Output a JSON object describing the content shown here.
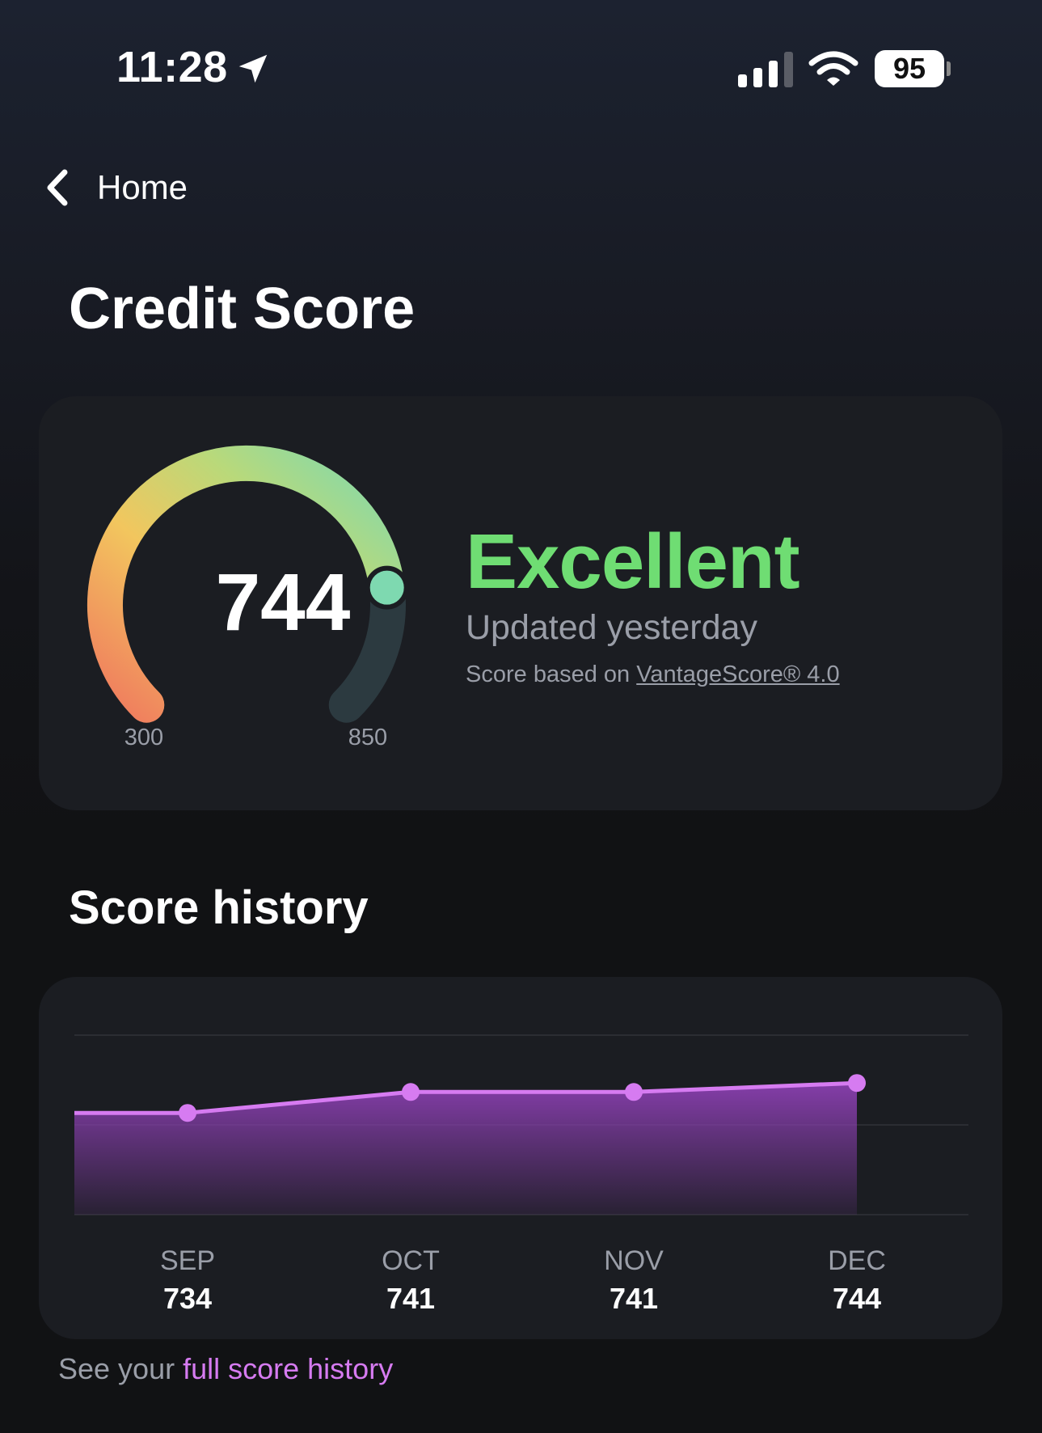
{
  "status_bar": {
    "time": "11:28",
    "battery": "95",
    "icons": [
      "location-arrow-icon",
      "signal-icon",
      "wifi-icon",
      "battery-icon"
    ]
  },
  "nav": {
    "back_label": "Home",
    "back_icon": "chevron-left-icon"
  },
  "page": {
    "title": "Credit Score"
  },
  "score_card": {
    "score": "744",
    "min_label": "300",
    "max_label": "850",
    "score_value": 744,
    "min_value": 300,
    "max_value": 850,
    "rating": "Excellent",
    "updated": "Updated yesterday",
    "based_on_prefix": "Score based on",
    "model_link": "VantageScore® 4.0",
    "colors": {
      "gauge_start": "#f07b5e",
      "gauge_mid1": "#f2c65e",
      "gauge_mid2": "#b9d97a",
      "gauge_end": "#7ed9b0",
      "gauge_track": "#2c3a40",
      "rating": "#6fdd73"
    }
  },
  "history": {
    "title": "Score history",
    "colors": {
      "line": "#d67bf1",
      "fill": "#8a3fb0",
      "grid": "#2b2d33"
    },
    "chart_data": {
      "type": "area",
      "categories": [
        "SEP",
        "OCT",
        "NOV",
        "DEC"
      ],
      "series": [
        {
          "values": [
            734,
            741,
            741,
            744
          ]
        }
      ],
      "value_labels": [
        "734",
        "741",
        "741",
        "744"
      ],
      "grid": true
    }
  },
  "footer": {
    "prefix": "See your",
    "link": "full score history"
  }
}
